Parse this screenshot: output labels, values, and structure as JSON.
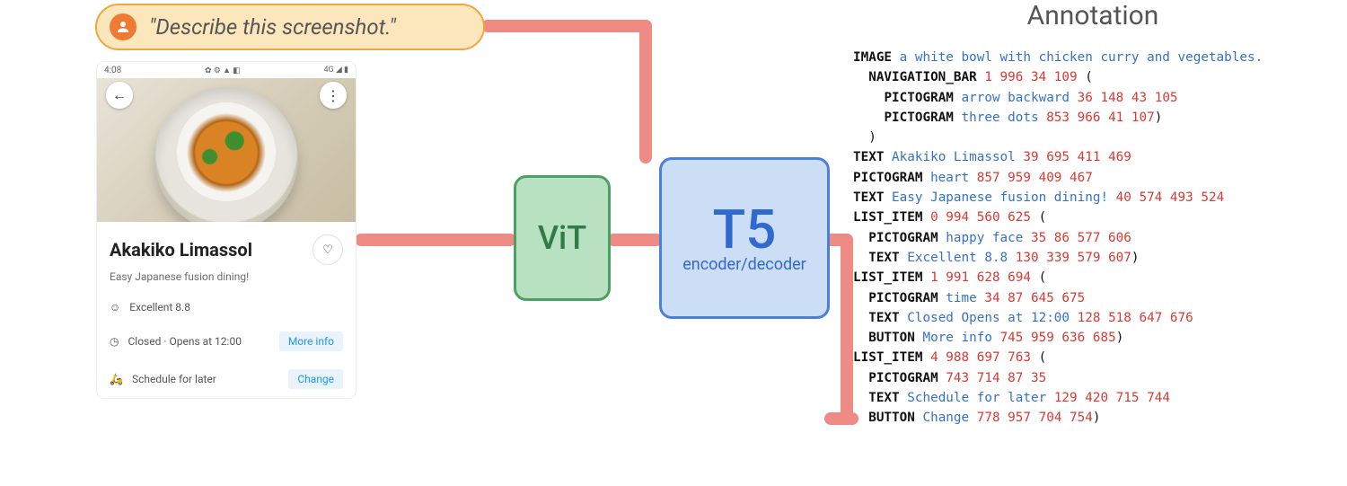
{
  "prompt": {
    "text": "\"Describe this screenshot.\""
  },
  "phone": {
    "status_time": "4:08",
    "status_left_icons": "✿ ⚙ ▲ ◧",
    "status_right_icons": "4G ◢ ▮",
    "back_icon": "←",
    "menu_icon": "⋮",
    "title": "Akakiko Limassol",
    "heart_icon": "♡",
    "subtitle": "Easy Japanese fusion dining!",
    "row1_icon": "☺",
    "row1_text": "Excellent 8.8",
    "row2_icon": "◷",
    "row2_text": "Closed · Opens at 12:00",
    "row2_btn": "More info",
    "row3_icon": "🛵",
    "row3_text": "Schedule for later",
    "row3_btn": "Change"
  },
  "vit": {
    "label": "ViT"
  },
  "t5": {
    "label": "T5",
    "sub": "encoder/decoder"
  },
  "annot": {
    "title": "Annotation",
    "lines": [
      [
        [
          "type",
          "IMAGE"
        ],
        [
          "sp",
          " "
        ],
        [
          "val",
          "a white bowl with chicken curry and vegetables."
        ]
      ],
      [
        [
          "sp",
          "  "
        ],
        [
          "type",
          "NAVIGATION_BAR"
        ],
        [
          "sp",
          " "
        ],
        [
          "num",
          "1 996 34 109"
        ],
        [
          "sp",
          " "
        ],
        [
          "punc",
          "("
        ]
      ],
      [
        [
          "sp",
          "    "
        ],
        [
          "type",
          "PICTOGRAM"
        ],
        [
          "sp",
          " "
        ],
        [
          "val",
          "arrow backward"
        ],
        [
          "sp",
          " "
        ],
        [
          "num",
          "36 148 43 105"
        ]
      ],
      [
        [
          "sp",
          "    "
        ],
        [
          "type",
          "PICTOGRAM"
        ],
        [
          "sp",
          " "
        ],
        [
          "val",
          "three dots"
        ],
        [
          "sp",
          " "
        ],
        [
          "num",
          "853 966 41 107"
        ],
        [
          "punc",
          ")"
        ]
      ],
      [
        [
          "sp",
          "  "
        ],
        [
          "punc",
          ")"
        ]
      ],
      [
        [
          "type",
          "TEXT"
        ],
        [
          "sp",
          " "
        ],
        [
          "val",
          "Akakiko Limassol"
        ],
        [
          "sp",
          " "
        ],
        [
          "num",
          "39 695 411 469"
        ]
      ],
      [
        [
          "type",
          "PICTOGRAM"
        ],
        [
          "sp",
          " "
        ],
        [
          "val",
          "heart"
        ],
        [
          "sp",
          " "
        ],
        [
          "num",
          "857 959 409 467"
        ]
      ],
      [
        [
          "type",
          "TEXT"
        ],
        [
          "sp",
          " "
        ],
        [
          "val",
          "Easy Japanese fusion dining!"
        ],
        [
          "sp",
          " "
        ],
        [
          "num",
          "40 574 493 524"
        ]
      ],
      [
        [
          "type",
          "LIST_ITEM"
        ],
        [
          "sp",
          " "
        ],
        [
          "num",
          "0 994 560 625"
        ],
        [
          "sp",
          " "
        ],
        [
          "punc",
          "("
        ]
      ],
      [
        [
          "sp",
          "  "
        ],
        [
          "type",
          "PICTOGRAM"
        ],
        [
          "sp",
          " "
        ],
        [
          "val",
          "happy face"
        ],
        [
          "sp",
          " "
        ],
        [
          "num",
          "35 86 577 606"
        ]
      ],
      [
        [
          "sp",
          "  "
        ],
        [
          "type",
          "TEXT"
        ],
        [
          "sp",
          " "
        ],
        [
          "val",
          "Excellent 8.8"
        ],
        [
          "sp",
          " "
        ],
        [
          "num",
          "130 339 579 607"
        ],
        [
          "punc",
          ")"
        ]
      ],
      [
        [
          "type",
          "LIST_ITEM"
        ],
        [
          "sp",
          " "
        ],
        [
          "num",
          "1 991 628 694"
        ],
        [
          "sp",
          " "
        ],
        [
          "punc",
          "("
        ]
      ],
      [
        [
          "sp",
          "  "
        ],
        [
          "type",
          "PICTOGRAM"
        ],
        [
          "sp",
          " "
        ],
        [
          "val",
          "time"
        ],
        [
          "sp",
          " "
        ],
        [
          "num",
          "34 87 645 675"
        ]
      ],
      [
        [
          "sp",
          "  "
        ],
        [
          "type",
          "TEXT"
        ],
        [
          "sp",
          " "
        ],
        [
          "val",
          "Closed Opens at 12:00"
        ],
        [
          "sp",
          " "
        ],
        [
          "num",
          "128 518 647 676"
        ]
      ],
      [
        [
          "sp",
          "  "
        ],
        [
          "type",
          "BUTTON"
        ],
        [
          "sp",
          " "
        ],
        [
          "val",
          "More info"
        ],
        [
          "sp",
          " "
        ],
        [
          "num",
          "745 959 636 685"
        ],
        [
          "punc",
          ")"
        ]
      ],
      [
        [
          "type",
          "LIST_ITEM"
        ],
        [
          "sp",
          " "
        ],
        [
          "num",
          "4 988 697 763"
        ],
        [
          "sp",
          " "
        ],
        [
          "punc",
          "("
        ]
      ],
      [
        [
          "sp",
          "  "
        ],
        [
          "type",
          "PICTOGRAM"
        ],
        [
          "sp",
          " "
        ],
        [
          "num",
          "743 714 87 35"
        ]
      ],
      [
        [
          "sp",
          "  "
        ],
        [
          "type",
          "TEXT"
        ],
        [
          "sp",
          " "
        ],
        [
          "val",
          "Schedule for later"
        ],
        [
          "sp",
          " "
        ],
        [
          "num",
          "129 420 715 744"
        ]
      ],
      [
        [
          "sp",
          "  "
        ],
        [
          "type",
          "BUTTON"
        ],
        [
          "sp",
          " "
        ],
        [
          "val",
          "Change"
        ],
        [
          "sp",
          " "
        ],
        [
          "num",
          "778 957 704 754"
        ],
        [
          "punc",
          ")"
        ]
      ]
    ]
  }
}
